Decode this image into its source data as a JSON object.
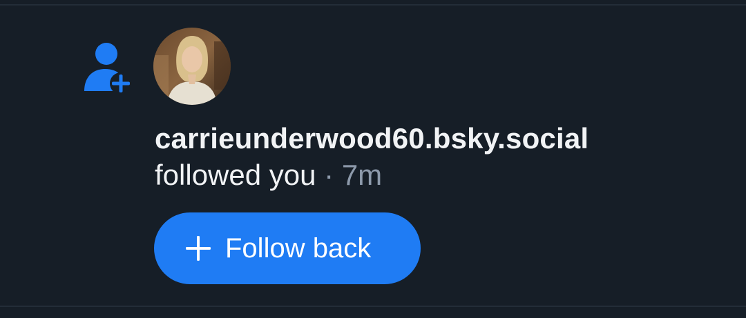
{
  "notification": {
    "type_icon": "person-add-icon",
    "avatar_icon": "user-avatar",
    "handle": "carrieunderwood60.bsky.social",
    "action_text": "followed you",
    "separator": "·",
    "timestamp": "7m",
    "follow_back_label": "Follow back",
    "follow_back_icon": "plus-icon"
  },
  "colors": {
    "background": "#161e27",
    "divider": "#232d38",
    "accent": "#1f7cf4",
    "primary_text": "#f1f3f5",
    "secondary_text": "#8d9aab"
  }
}
